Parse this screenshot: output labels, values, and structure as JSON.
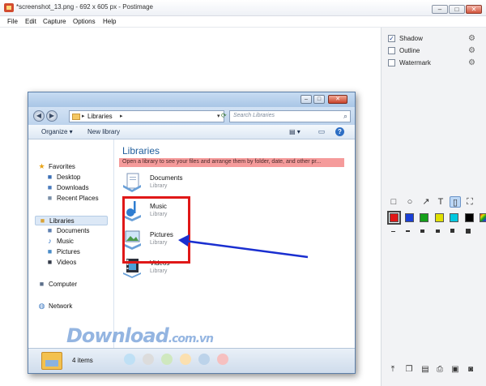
{
  "app": {
    "title": "*screenshot_13.png - 692 x 605 px - Postimage",
    "window_buttons": [
      "–",
      "□",
      "✕"
    ],
    "menu": [
      "File",
      "Edit",
      "Capture",
      "Options",
      "Help"
    ]
  },
  "panel": {
    "options": [
      {
        "label": "Shadow",
        "checked": true,
        "mark": "✓"
      },
      {
        "label": "Outline",
        "checked": false,
        "mark": ""
      },
      {
        "label": "Watermark",
        "checked": false,
        "mark": ""
      }
    ],
    "gear": "⚙",
    "tools_row1": [
      "rectangle-icon",
      "ellipse-icon",
      "arrow-icon",
      "text-icon",
      "line-icon",
      "crop-icon"
    ],
    "tools_row1_glyphs": [
      "□",
      "○",
      "↗",
      "T",
      "▯",
      "⛶"
    ],
    "active_tool": "line-icon",
    "colors": [
      "#e01818",
      "#1a3fd6",
      "#15a01a",
      "#e0e000",
      "#00c8e0",
      "#000000",
      "rainbow"
    ],
    "selected_color": "#e01818",
    "bottom_icons": [
      "upload-icon",
      "copy-icon",
      "save-icon",
      "print-icon",
      "open-icon",
      "camera-icon"
    ],
    "bottom_glyphs": [
      "⤒",
      "❐",
      "▤",
      "⎙",
      "▣",
      "◙"
    ]
  },
  "explorer": {
    "window_buttons": [
      "–",
      "□",
      "✕"
    ],
    "nav_back": "◀",
    "nav_forward": "▶",
    "address": "Libraries",
    "search_placeholder": "Search Libraries",
    "search_icon": "⌕",
    "toolbar": {
      "organize": "Organize ▾",
      "new_library": "New library",
      "views": "▤ ▾",
      "preview": "▭",
      "help": "?"
    },
    "nav_pane": [
      {
        "label": "Favorites",
        "icon": "★",
        "color": "#e8a317",
        "indent": 0
      },
      {
        "label": "Desktop",
        "icon": "■",
        "color": "#3b6fb5",
        "indent": 1
      },
      {
        "label": "Downloads",
        "icon": "■",
        "color": "#4a7bbd",
        "indent": 1
      },
      {
        "label": "Recent Places",
        "icon": "■",
        "color": "#7a8fa8",
        "indent": 1
      },
      {
        "label": "Libraries",
        "icon": "■",
        "color": "#d9a338",
        "indent": 0,
        "selected": true
      },
      {
        "label": "Documents",
        "icon": "■",
        "color": "#5d7fb0",
        "indent": 1
      },
      {
        "label": "Music",
        "icon": "♪",
        "color": "#2b6fc2",
        "indent": 1
      },
      {
        "label": "Pictures",
        "icon": "■",
        "color": "#4a8cc8",
        "indent": 1
      },
      {
        "label": "Videos",
        "icon": "■",
        "color": "#333a48",
        "indent": 1
      },
      {
        "label": "Computer",
        "icon": "■",
        "color": "#5b6f8a",
        "indent": 0
      },
      {
        "label": "Network",
        "icon": "◍",
        "color": "#3c78c0",
        "indent": 0
      }
    ],
    "heading": "Libraries",
    "info_bar": "Open a library to see your files and arrange them by folder, date, and other pr...",
    "libraries": [
      {
        "name": "Documents",
        "type": "Library"
      },
      {
        "name": "Music",
        "type": "Library"
      },
      {
        "name": "Pictures",
        "type": "Library"
      },
      {
        "name": "Videos",
        "type": "Library"
      }
    ],
    "status": "4 items"
  },
  "watermark": {
    "main": "Download",
    "sub": ".com.vn"
  },
  "dots": [
    "#bfe0f5",
    "#dcdcdc",
    "#cfe8bf",
    "#fbe0b0",
    "#bcd3ea",
    "#f6c0c0"
  ]
}
